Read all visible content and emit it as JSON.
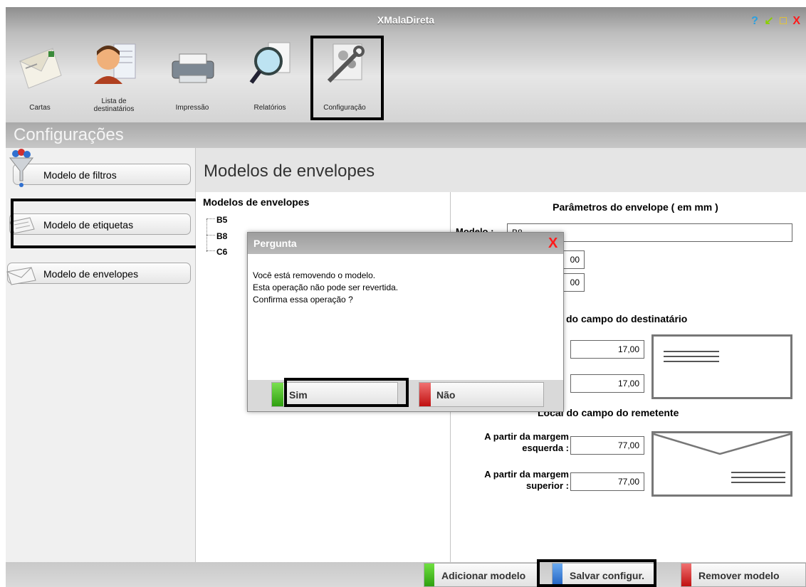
{
  "app": {
    "title": "XMalaDireta",
    "window_controls": {
      "help": "?",
      "minimize": "↙",
      "maximize": "□",
      "close": "X"
    }
  },
  "toolbar": {
    "items": [
      {
        "label": "Cartas",
        "icon": "envelope-icon"
      },
      {
        "label": "Lista de\ndestinatários",
        "icon": "person-list-icon"
      },
      {
        "label": "Impressão",
        "icon": "printer-icon"
      },
      {
        "label": "Relatórios",
        "icon": "magnifier-icon"
      },
      {
        "label": "Configuração",
        "icon": "wrench-gears-icon",
        "selected": true
      }
    ]
  },
  "section": {
    "title": "Configurações"
  },
  "sidebar": {
    "items": [
      {
        "label": "Modelo de filtros",
        "icon": "funnel-icon"
      },
      {
        "label": "Modelo de etiquetas",
        "icon": "labels-icon"
      },
      {
        "label": "Modelo de envelopes",
        "icon": "envelope-icon"
      }
    ]
  },
  "main": {
    "title": "Modelos de envelopes",
    "list": {
      "title": "Modelos de envelopes",
      "items": [
        "B5",
        "B8",
        "C6"
      ]
    },
    "params": {
      "title": "Parâmetros do envelope  ( em mm )",
      "model_label": "Modelo :",
      "model_value": "B8",
      "width_value": "00",
      "height_value": "00",
      "dest_section": "do campo do destinatário",
      "dest_left_value": "17,00",
      "dest_top_value": "17,00",
      "rem_section": "Local do campo do remetente",
      "rem_left_label": "A partir da margem\nesquerda :",
      "rem_left_value": "77,00",
      "rem_top_label": "A partir da margem\nsuperior :",
      "rem_top_value": "77,00"
    }
  },
  "bottom": {
    "add_label": "Adicionar modelo",
    "save_label": "Salvar configur.",
    "remove_label": "Remover modelo"
  },
  "dialog": {
    "title": "Pergunta",
    "close": "X",
    "message": "Você está removendo o modelo.\nEsta operação não pode ser revertida.\nConfirma essa operação ?",
    "yes_label": "Sim",
    "no_label": "Não"
  },
  "colors": {
    "green": "#3fbf1f",
    "blue": "#2d7be0",
    "red": "#e02020"
  }
}
